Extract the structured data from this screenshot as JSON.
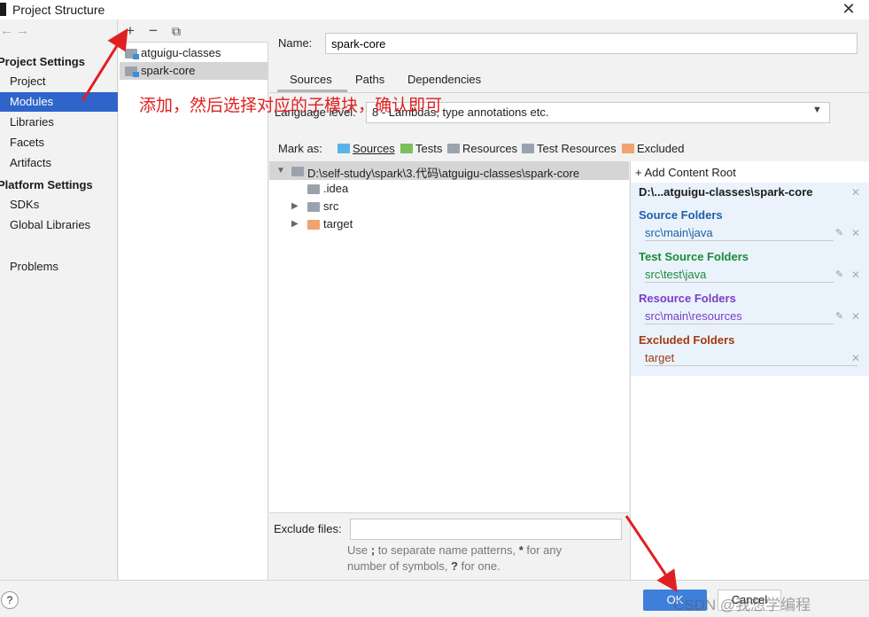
{
  "window": {
    "title": "Project Structure",
    "close_glyph": "✕"
  },
  "nav": {
    "back_glyph": "←",
    "forward_glyph": "→",
    "project_settings_heading": "Project Settings",
    "project_settings_items": [
      "Project",
      "Modules",
      "Libraries",
      "Facets",
      "Artifacts"
    ],
    "platform_settings_heading": "Platform Settings",
    "platform_settings_items": [
      "SDKs",
      "Global Libraries"
    ],
    "problems": "Problems",
    "selected": "Modules"
  },
  "module_toolbar": {
    "add_glyph": "+",
    "remove_glyph": "−",
    "copy_glyph": "⧉"
  },
  "modules": [
    {
      "name": "atguigu-classes",
      "icon": "module-folder-icon"
    },
    {
      "name": "spark-core",
      "icon": "module-folder-icon",
      "selected": true
    }
  ],
  "module_settings": {
    "name_label": "Name:",
    "name_value": "spark-core",
    "tabs": [
      "Sources",
      "Paths",
      "Dependencies"
    ],
    "active_tab": "Sources",
    "language_level_label": "Language level:",
    "language_level_value": "8 - Lambdas, type annotations etc.",
    "mark_as_label": "Mark as:",
    "mark_as": [
      {
        "label": "Sources",
        "color": "#5ab3e8"
      },
      {
        "label": "Tests",
        "color": "#7cbf5a"
      },
      {
        "label": "Resources",
        "color": "#9aa3ad"
      },
      {
        "label": "Test Resources",
        "color": "#9aa3ad"
      },
      {
        "label": "Excluded",
        "color": "#f0a36d"
      }
    ]
  },
  "tree": {
    "root": "D:\\self-study\\spark\\3.代码\\atguigu-classes\\spark-core",
    "children": [
      {
        "name": ".idea",
        "expandable": false,
        "color": "#9aa3ad"
      },
      {
        "name": "src",
        "expandable": true,
        "color": "#9aa3ad"
      },
      {
        "name": "target",
        "expandable": true,
        "color": "#f0a36d"
      }
    ]
  },
  "exclude": {
    "label": "Exclude files:",
    "value": "",
    "hint_line1_a": "Use ",
    "hint_line1_b": ";",
    "hint_line1_c": " to separate name patterns, ",
    "hint_line1_d": "*",
    "hint_line1_e": " for any",
    "hint_line2_a": "number of symbols, ",
    "hint_line2_b": "?",
    "hint_line2_c": " for one."
  },
  "content_root": {
    "add_label": "Add Content Root",
    "path": "D:\\...atguigu-classes\\spark-core",
    "groups": [
      {
        "heading": "Source Folders",
        "path": "src\\main\\java",
        "color": "#1f5ea8",
        "editable": true
      },
      {
        "heading": "Test Source Folders",
        "path": "src\\test\\java",
        "color": "#1d8a3a",
        "editable": true
      },
      {
        "heading": "Resource Folders",
        "path": "src\\main\\resources",
        "color": "#7a3ccc",
        "editable": true
      },
      {
        "heading": "Excluded Folders",
        "path": "target",
        "color": "#a33a10",
        "editable": false
      }
    ]
  },
  "buttons": {
    "help": "?",
    "ok": "OK",
    "cancel": "Cancel"
  },
  "annotation": {
    "text": "添加，然后选择对应的子模块，确认即可",
    "color": "#e02020"
  },
  "watermark": "CSDN @我想学编程"
}
